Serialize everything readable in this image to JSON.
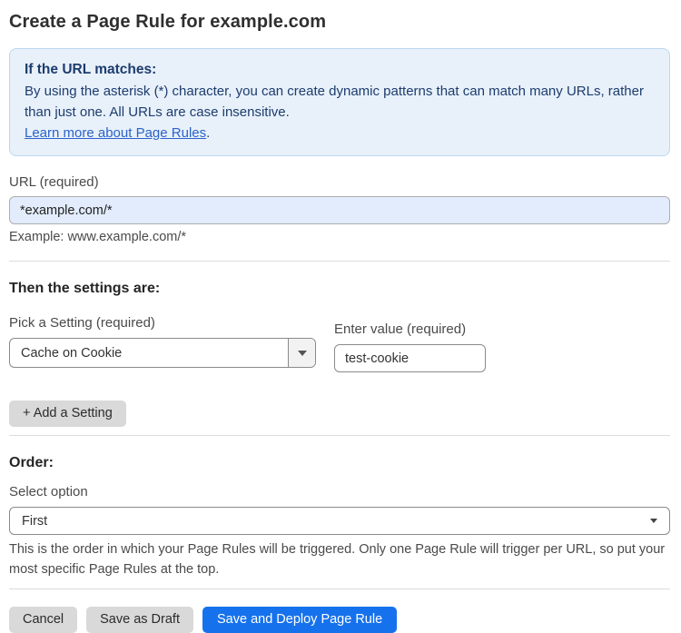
{
  "page": {
    "title": "Create a Page Rule for example.com"
  },
  "info_box": {
    "heading": "If the URL matches:",
    "body": "By using the asterisk (*) character, you can create dynamic patterns that can match many URLs, rather than just one. All URLs are case insensitive.",
    "link_label": "Learn more about Page Rules",
    "link_suffix": "."
  },
  "url_field": {
    "label": "URL (required)",
    "value": "*example.com/*",
    "example": "Example: www.example.com/*"
  },
  "settings": {
    "heading": "Then the settings are:",
    "setting_label": "Pick a Setting (required)",
    "setting_selected": "Cache on Cookie",
    "value_label": "Enter value (required)",
    "value_text": "test-cookie",
    "add_button_label": "+ Add a Setting"
  },
  "order": {
    "heading": "Order:",
    "label": "Select option",
    "selected": "First",
    "help": "This is the order in which your Page Rules will be triggered. Only one Page Rule will trigger per URL, so put your most specific Page Rules at the top."
  },
  "actions": {
    "cancel_label": "Cancel",
    "save_draft_label": "Save as Draft",
    "save_deploy_label": "Save and Deploy Page Rule"
  },
  "colors": {
    "primary_blue": "#1672ec",
    "info_box_bg": "#e8f1fa",
    "info_box_border": "#bcd7ef",
    "info_text_navy": "#1d3c6e",
    "link_blue": "#2c62c9",
    "url_input_bg": "#e2ecfc",
    "gray_button_bg": "#d9d9d9",
    "field_border_gray": "#8a8a8a"
  }
}
